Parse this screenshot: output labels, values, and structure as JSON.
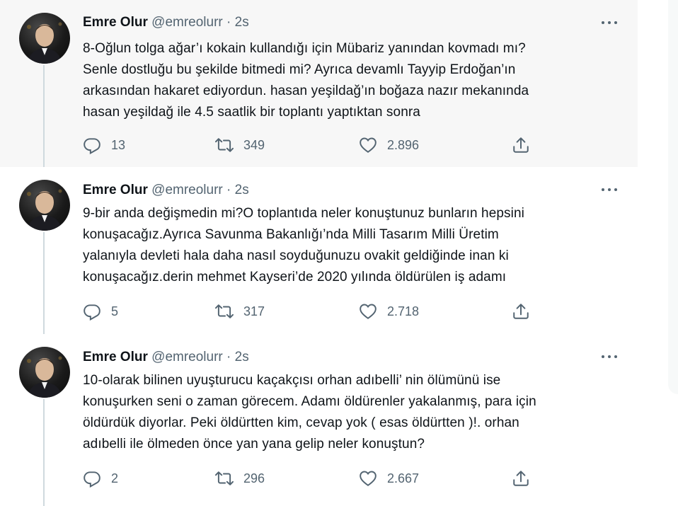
{
  "tweets": [
    {
      "name": "Emre Olur",
      "handle": "@emreolurr",
      "separator": "·",
      "time": "2s",
      "lines": [
        "8-Oğlun tolga ağar’ı kokain kullandığı için Mübariz yanından kovmadı mı?",
        "Senle dostluğu bu şekilde bitmedi mi? Ayrıca devamlı Tayyip Erdoğan’ın",
        "arkasından hakaret ediyordun. hasan yeşildağ’ın boğaza nazır mekanında",
        "hasan yeşildağ ile 4.5 saatlik bir toplantı yaptıktan sonra"
      ],
      "replies": "13",
      "retweets": "349",
      "likes": "2.896"
    },
    {
      "name": "Emre Olur",
      "handle": "@emreolurr",
      "separator": "·",
      "time": "2s",
      "lines": [
        "9-bir anda değişmedin mi?O toplantıda neler konuştunuz bunların hepsini",
        "konuşacağız.Ayrıca Savunma Bakanlığı’nda Milli Tasarım Milli Üretim",
        "yalanıyla devleti hala daha nasıl soyduğunuzu ovakit geldiğinde inan ki",
        "konuşacağız.derin mehmet Kayseri’de 2020 yılında öldürülen iş adamı"
      ],
      "replies": "5",
      "retweets": "317",
      "likes": "2.718"
    },
    {
      "name": "Emre Olur",
      "handle": "@emreolurr",
      "separator": "·",
      "time": "2s",
      "lines": [
        "10-olarak bilinen uyuşturucu kaçakçısı orhan adıbelli’ nin ölümünü ise",
        "konuşurken seni o zaman görecem. Adamı öldürenler yakalanmış, para için",
        "öldürdük diyorlar. Peki öldürtten kim, cevap yok ( esas öldürtten )!. orhan",
        "adıbelli ile ölmeden önce yan yana gelip neler konuştun?"
      ],
      "replies": "2",
      "retweets": "296",
      "likes": "2.667"
    }
  ],
  "icons": {
    "reply": "reply-icon",
    "retweet": "retweet-icon",
    "like": "heart-icon",
    "share": "share-icon",
    "more": "more-icon"
  },
  "colors": {
    "text": "#0f1419",
    "secondary": "#536471",
    "highlight_bg": "#f7f7f7",
    "thread_line": "#cfd9de"
  }
}
